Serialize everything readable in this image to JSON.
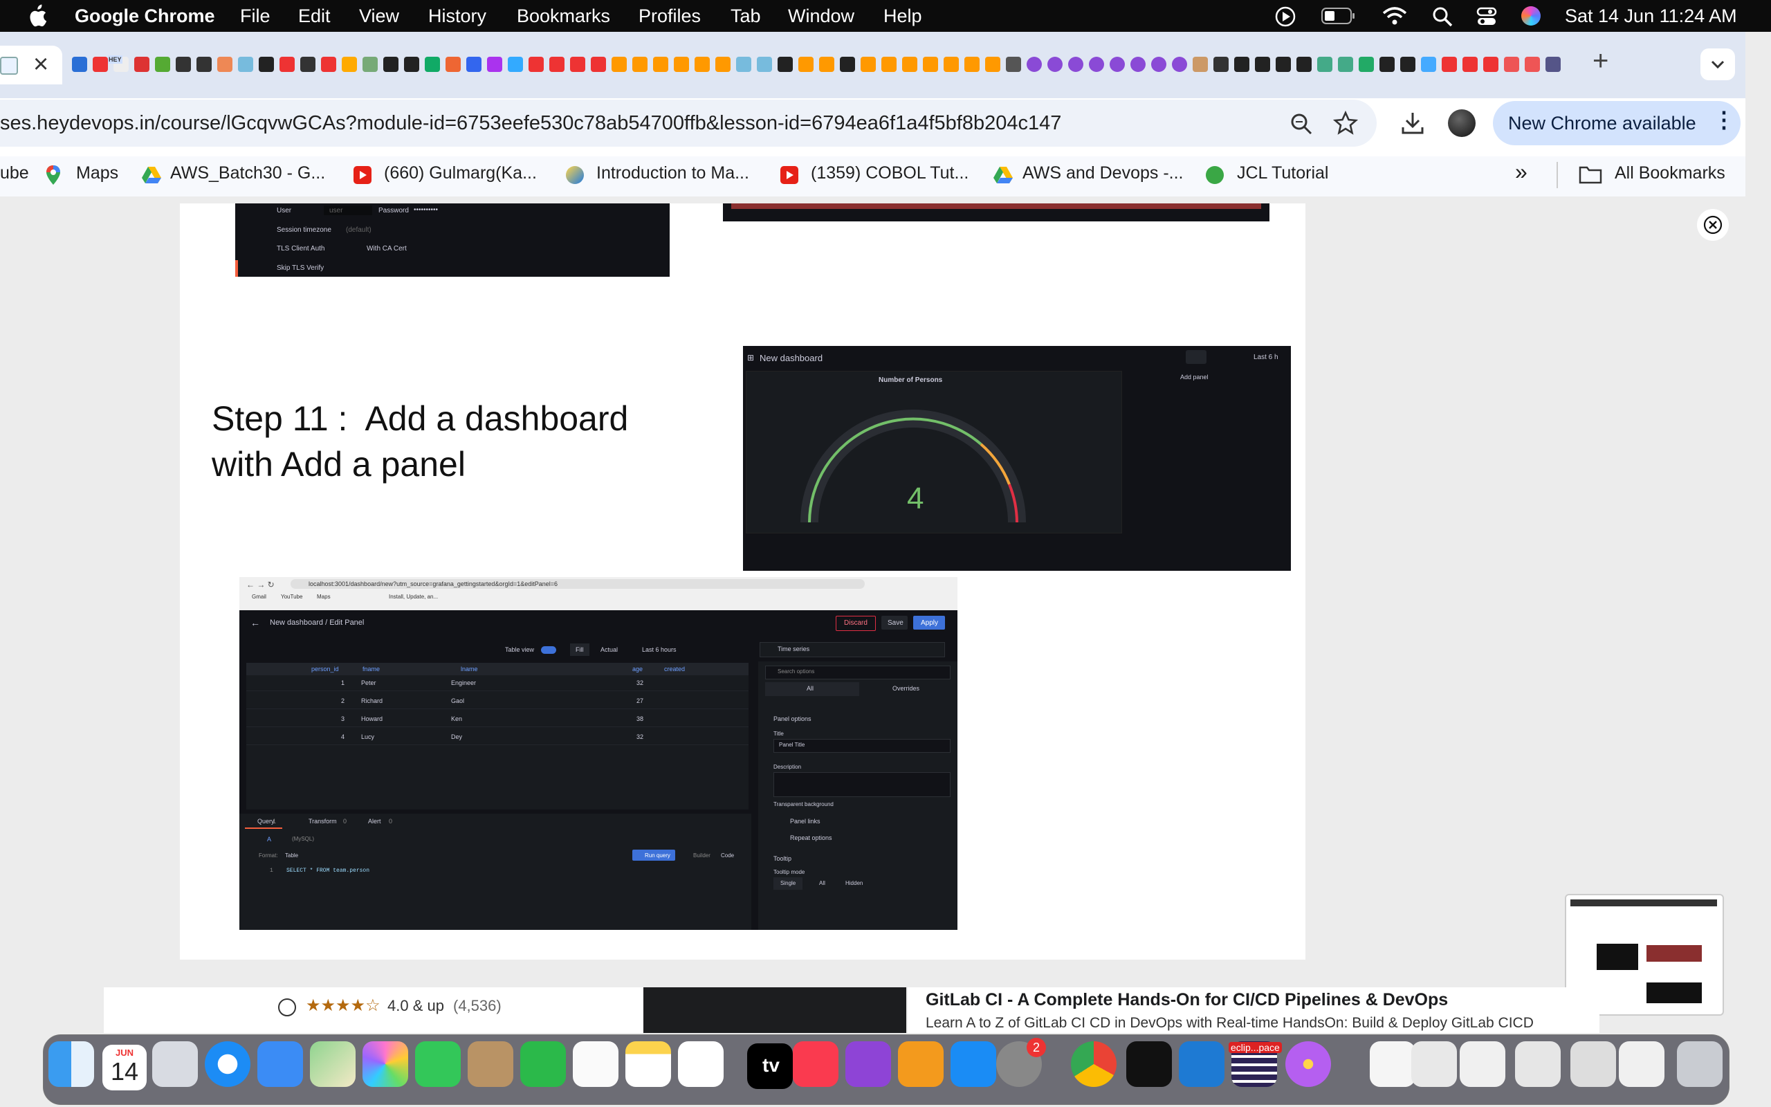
{
  "menubar": {
    "app_name": "Google Chrome",
    "items": [
      "File",
      "Edit",
      "View",
      "History",
      "Bookmarks",
      "Profiles",
      "Tab",
      "Window",
      "Help"
    ],
    "datetime": "Sat 14 Jun  11:24 AM"
  },
  "tabs": {
    "new_tab_symbol": "+",
    "close_symbol": "×",
    "tiny_labels": [
      "HEY"
    ]
  },
  "address_bar": {
    "url": "ses.heydevops.in/course/lGcqvwGCAs?module-id=6753eefe530c78ab54700ffb&lesson-id=6794ea6f1a4f5bf8b204c147",
    "update_button": "New Chrome available"
  },
  "bookmarks": {
    "items": [
      "ube",
      "Maps",
      "AWS_Batch30 - G...",
      "(660) Gulmarg(Ka...",
      "Introduction to Ma...",
      "(1359) COBOL Tut...",
      "AWS and Devops -...",
      "JCL Tutorial"
    ],
    "overflow": "»",
    "all": "All Bookmarks"
  },
  "slide": {
    "step_title_line1": "Step 11 :  Add a dashboard",
    "step_title_line2": "with Add a panel",
    "db_form": {
      "user": "User",
      "user_ph": "user",
      "password": "Password",
      "password_val": "••••••••••",
      "session": "Session timezone",
      "session_val": "(default)",
      "tls_client": "TLS Client Auth",
      "ca_cert": "With CA Cert",
      "skip_tls": "Skip TLS Verify"
    },
    "gauge_panel": {
      "dashboard_title": "New dashboard",
      "panel_title": "Number of Persons",
      "value": "4",
      "add_panel_tooltip": "Add panel",
      "time_range": "Last 6 h"
    },
    "edit_panel": {
      "url": "localhost:3001/dashboard/new?utm_source=grafana_gettingstarted&orgId=1&editPanel=6",
      "bookmarks": [
        "Gmail",
        "YouTube",
        "Maps",
        "Install, Update, an..."
      ],
      "header": "New dashboard / Edit Panel",
      "discard": "Discard",
      "save": "Save",
      "apply": "Apply",
      "table_view": "Table view",
      "fill": "Fill",
      "actual": "Actual",
      "time": "Last 6 hours",
      "viz": "Time series",
      "columns": [
        "person_id",
        "fname",
        "lname",
        "age",
        "created"
      ],
      "rows": [
        [
          "1",
          "Peter",
          "Engineer",
          "32"
        ],
        [
          "2",
          "Richard",
          "Gaol",
          "27"
        ],
        [
          "3",
          "Howard",
          "Ken",
          "38"
        ],
        [
          "4",
          "Lucy",
          "Dey",
          "32"
        ]
      ],
      "query_tabs": [
        "Query",
        "Transform",
        "Alert"
      ],
      "query_counts": [
        "1",
        "0",
        "0"
      ],
      "query_letter": "A",
      "datasource": "(MySQL)",
      "format_label": "Format:",
      "format_val": "Table",
      "run_query": "Run query",
      "builder": "Builder",
      "code": "Code",
      "sql_line": "1",
      "sql": "SELECT * FROM team.person",
      "search_options": "Search options",
      "opt_tabs": [
        "All",
        "Overrides"
      ],
      "panel_options": "Panel options",
      "title_label": "Title",
      "title_val": "Panel Title",
      "description": "Description",
      "transparent": "Transparent background",
      "panel_links": "Panel links",
      "repeat_options": "Repeat options",
      "tooltip": "Tooltip",
      "tooltip_mode": "Tooltip mode",
      "tooltip_opts": [
        "Single",
        "All",
        "Hidden"
      ]
    }
  },
  "course_card": {
    "rating": "4.0 & up",
    "count": "(4,536)",
    "title": "GitLab CI - A Complete Hands-On for CI/CD Pipelines & DevOps",
    "subtitle": "Learn A to Z of GitLab CI CD in DevOps with Real-time HandsOn: Build & Deploy GitLab CICD"
  },
  "dock": {
    "calendar_month": "JUN",
    "calendar_day": "14",
    "settings_badge": "2",
    "eclipse_label": "eclip...pace",
    "appletv": "tv"
  },
  "colors": {
    "grafana_blue": "#3d71d9",
    "grafana_bg": "#111217",
    "chrome_tab": "#dfe6f3",
    "dock": "#3c3c46"
  }
}
